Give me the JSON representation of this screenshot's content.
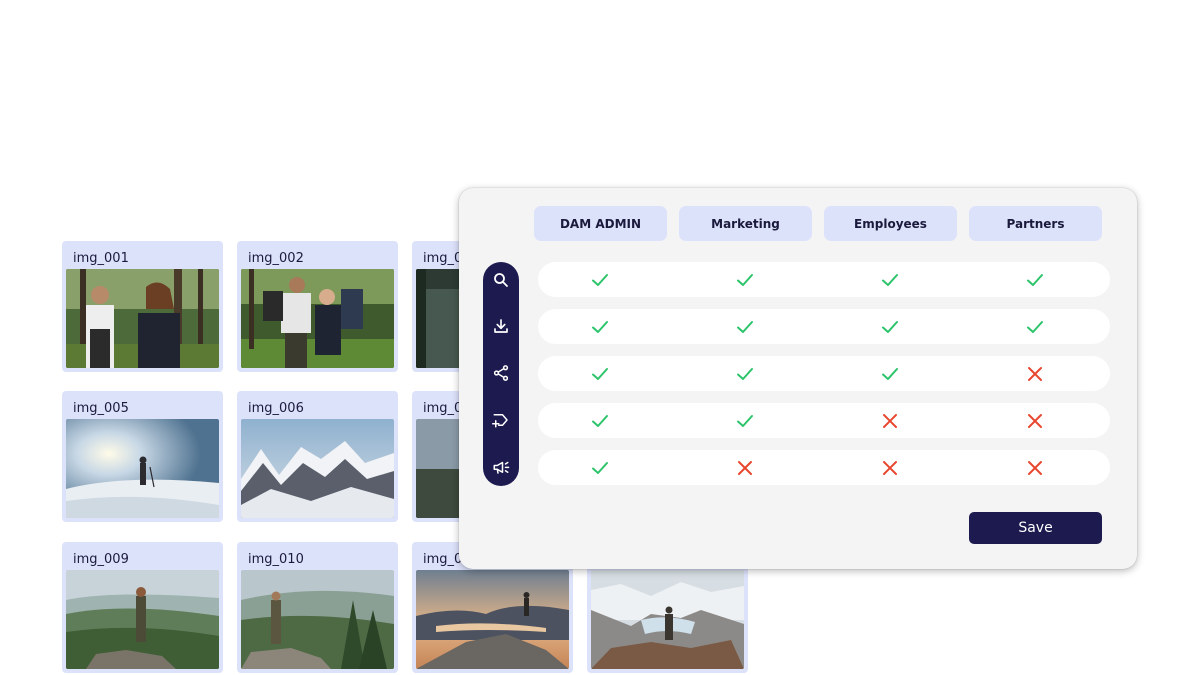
{
  "tiles": [
    {
      "label": "img_001"
    },
    {
      "label": "img_002"
    },
    {
      "label": "img_0"
    },
    {
      "label": "img_005"
    },
    {
      "label": "img_006"
    },
    {
      "label": "img_0"
    },
    {
      "label": "img_009"
    },
    {
      "label": "img_010"
    },
    {
      "label": "img_0"
    }
  ],
  "permissions": {
    "roles": [
      "DAM ADMIN",
      "Marketing",
      "Employees",
      "Partners"
    ],
    "actions": [
      {
        "icon": "search-icon",
        "access": [
          true,
          true,
          true,
          true
        ]
      },
      {
        "icon": "download-icon",
        "access": [
          true,
          true,
          true,
          true
        ]
      },
      {
        "icon": "share-icon",
        "access": [
          true,
          true,
          true,
          false
        ]
      },
      {
        "icon": "tag-add-icon",
        "access": [
          true,
          true,
          false,
          false
        ]
      },
      {
        "icon": "megaphone-icon",
        "access": [
          true,
          false,
          false,
          false
        ]
      }
    ],
    "save_label": "Save"
  },
  "colors": {
    "accent": "#1c1a4f",
    "header_bg": "#dde2fb",
    "allowed": "#2cc46b",
    "denied": "#e8472f"
  }
}
